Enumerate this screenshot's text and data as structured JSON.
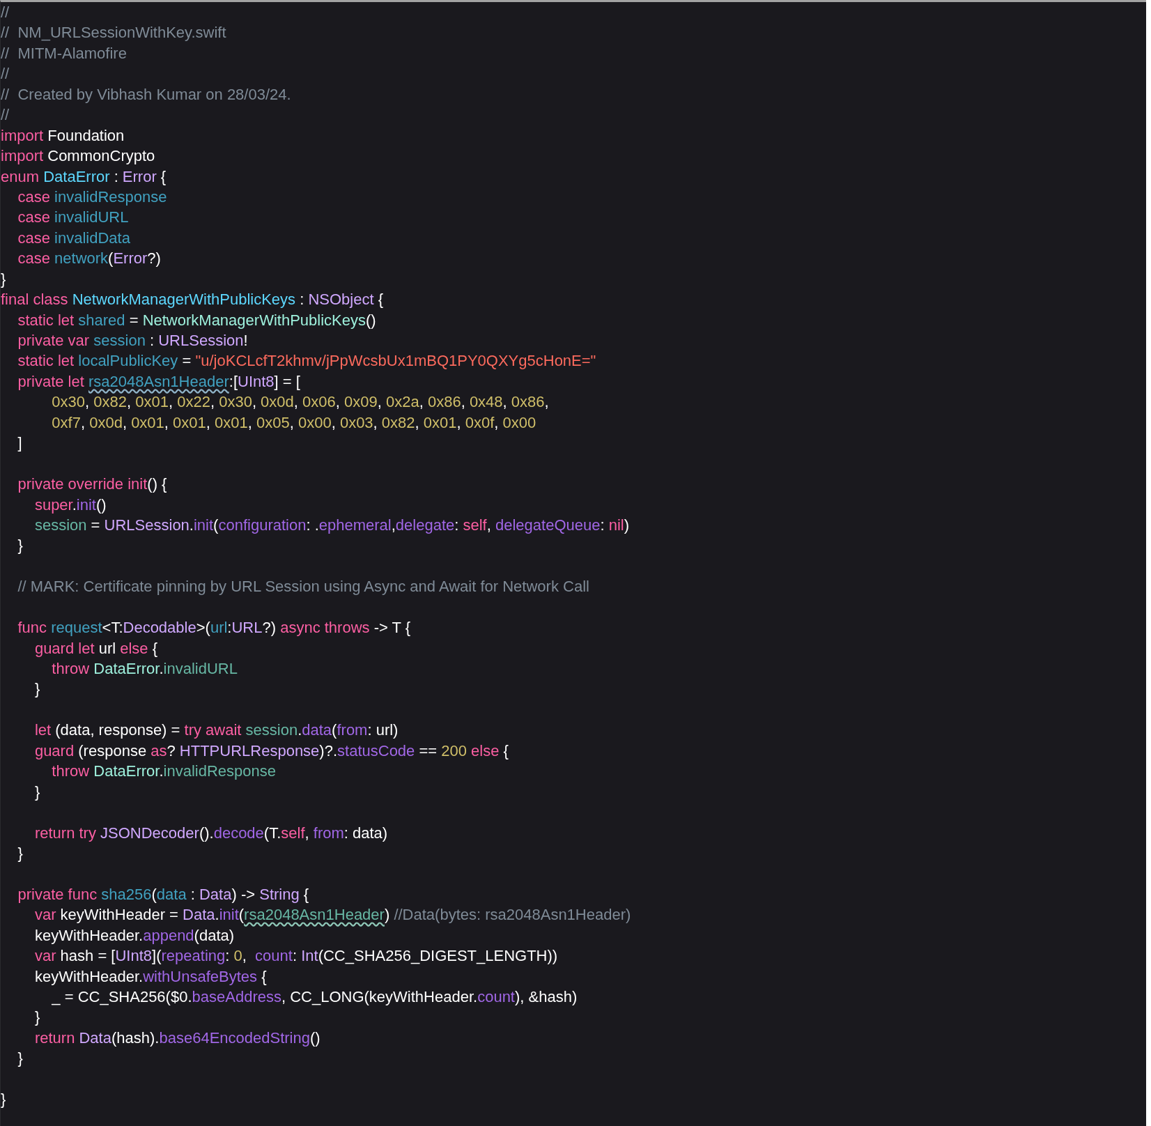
{
  "editor": {
    "lines": [
      {
        "kind": "code",
        "tokens": [
          {
            "text": "//",
            "kind": "comment"
          }
        ]
      },
      {
        "kind": "code",
        "tokens": [
          {
            "text": "//  NM_URLSessionWithKey.swift",
            "kind": "comment"
          }
        ]
      },
      {
        "kind": "code",
        "tokens": [
          {
            "text": "//  MITM-Alamofire",
            "kind": "comment"
          }
        ]
      },
      {
        "kind": "code",
        "tokens": [
          {
            "text": "//",
            "kind": "comment"
          }
        ]
      },
      {
        "kind": "code",
        "tokens": [
          {
            "text": "//  Created by Vibhash Kumar on 28/03/24.",
            "kind": "comment"
          }
        ]
      },
      {
        "kind": "code",
        "tokens": [
          {
            "text": "//",
            "kind": "comment"
          }
        ]
      },
      {
        "kind": "code",
        "tokens": [
          {
            "text": "import ",
            "kind": "keyword"
          },
          {
            "text": "Foundation",
            "kind": "plain"
          }
        ]
      },
      {
        "kind": "code",
        "tokens": [
          {
            "text": "import ",
            "kind": "keyword"
          },
          {
            "text": "CommonCrypto",
            "kind": "plain"
          }
        ]
      },
      {
        "kind": "code",
        "tokens": [
          {
            "text": "enum ",
            "kind": "keyword"
          },
          {
            "text": "DataError",
            "kind": "decl-type"
          },
          {
            "text": " : ",
            "kind": "plain"
          },
          {
            "text": "Error",
            "kind": "type"
          },
          {
            "text": " {",
            "kind": "plain"
          }
        ]
      },
      {
        "kind": "code",
        "tokens": [
          {
            "text": "    case ",
            "kind": "keyword"
          },
          {
            "text": "invalidResponse",
            "kind": "decl"
          }
        ]
      },
      {
        "kind": "code",
        "tokens": [
          {
            "text": "    case ",
            "kind": "keyword"
          },
          {
            "text": "invalidURL",
            "kind": "decl"
          }
        ]
      },
      {
        "kind": "code",
        "tokens": [
          {
            "text": "    case ",
            "kind": "keyword"
          },
          {
            "text": "invalidData",
            "kind": "decl"
          }
        ]
      },
      {
        "kind": "code",
        "tokens": [
          {
            "text": "    case ",
            "kind": "keyword"
          },
          {
            "text": "network",
            "kind": "decl"
          },
          {
            "text": "(",
            "kind": "plain"
          },
          {
            "text": "Error",
            "kind": "type"
          },
          {
            "text": "?)",
            "kind": "plain"
          }
        ]
      },
      {
        "kind": "code",
        "tokens": [
          {
            "text": "}",
            "kind": "plain"
          }
        ]
      },
      {
        "kind": "code",
        "tokens": [
          {
            "text": "final class ",
            "kind": "keyword"
          },
          {
            "text": "NetworkManagerWithPublicKeys",
            "kind": "decl-type"
          },
          {
            "text": " : ",
            "kind": "plain"
          },
          {
            "text": "NSObject",
            "kind": "type"
          },
          {
            "text": " {",
            "kind": "plain"
          }
        ]
      },
      {
        "kind": "code",
        "tokens": [
          {
            "text": "    static let ",
            "kind": "keyword"
          },
          {
            "text": "shared",
            "kind": "decl"
          },
          {
            "text": " = ",
            "kind": "plain"
          },
          {
            "text": "NetworkManagerWithPublicKeys",
            "kind": "proj-type"
          },
          {
            "text": "()",
            "kind": "plain"
          }
        ]
      },
      {
        "kind": "code",
        "tokens": [
          {
            "text": "    private var ",
            "kind": "keyword"
          },
          {
            "text": "session",
            "kind": "decl"
          },
          {
            "text": " : ",
            "kind": "plain"
          },
          {
            "text": "URLSession",
            "kind": "type"
          },
          {
            "text": "!",
            "kind": "plain"
          }
        ]
      },
      {
        "kind": "code",
        "tokens": [
          {
            "text": "    static let ",
            "kind": "keyword"
          },
          {
            "text": "localPublicKey",
            "kind": "decl"
          },
          {
            "text": " = ",
            "kind": "plain"
          },
          {
            "text": "\"u/joKCLcfT2khmv/jPpWcsbUx1mBQ1PY0QXYg5cHonE=\"",
            "kind": "string"
          }
        ]
      },
      {
        "kind": "code",
        "tokens": [
          {
            "text": "    private let ",
            "kind": "keyword"
          },
          {
            "text": "rsa2048Asn1Header",
            "kind": "decl-warn"
          },
          {
            "text": ":[",
            "kind": "plain"
          },
          {
            "text": "UInt8",
            "kind": "type"
          },
          {
            "text": "] = [",
            "kind": "plain"
          }
        ]
      },
      {
        "kind": "code",
        "tokens": [
          {
            "text": "            0x30",
            "kind": "number"
          },
          {
            "text": ", ",
            "kind": "plain"
          },
          {
            "text": "0x82",
            "kind": "number"
          },
          {
            "text": ", ",
            "kind": "plain"
          },
          {
            "text": "0x01",
            "kind": "number"
          },
          {
            "text": ", ",
            "kind": "plain"
          },
          {
            "text": "0x22",
            "kind": "number"
          },
          {
            "text": ", ",
            "kind": "plain"
          },
          {
            "text": "0x30",
            "kind": "number"
          },
          {
            "text": ", ",
            "kind": "plain"
          },
          {
            "text": "0x0d",
            "kind": "number"
          },
          {
            "text": ", ",
            "kind": "plain"
          },
          {
            "text": "0x06",
            "kind": "number"
          },
          {
            "text": ", ",
            "kind": "plain"
          },
          {
            "text": "0x09",
            "kind": "number"
          },
          {
            "text": ", ",
            "kind": "plain"
          },
          {
            "text": "0x2a",
            "kind": "number"
          },
          {
            "text": ", ",
            "kind": "plain"
          },
          {
            "text": "0x86",
            "kind": "number"
          },
          {
            "text": ", ",
            "kind": "plain"
          },
          {
            "text": "0x48",
            "kind": "number"
          },
          {
            "text": ", ",
            "kind": "plain"
          },
          {
            "text": "0x86",
            "kind": "number"
          },
          {
            "text": ",",
            "kind": "plain"
          }
        ]
      },
      {
        "kind": "code",
        "tokens": [
          {
            "text": "            0xf7",
            "kind": "number"
          },
          {
            "text": ", ",
            "kind": "plain"
          },
          {
            "text": "0x0d",
            "kind": "number"
          },
          {
            "text": ", ",
            "kind": "plain"
          },
          {
            "text": "0x01",
            "kind": "number"
          },
          {
            "text": ", ",
            "kind": "plain"
          },
          {
            "text": "0x01",
            "kind": "number"
          },
          {
            "text": ", ",
            "kind": "plain"
          },
          {
            "text": "0x01",
            "kind": "number"
          },
          {
            "text": ", ",
            "kind": "plain"
          },
          {
            "text": "0x05",
            "kind": "number"
          },
          {
            "text": ", ",
            "kind": "plain"
          },
          {
            "text": "0x00",
            "kind": "number"
          },
          {
            "text": ", ",
            "kind": "plain"
          },
          {
            "text": "0x03",
            "kind": "number"
          },
          {
            "text": ", ",
            "kind": "plain"
          },
          {
            "text": "0x82",
            "kind": "number"
          },
          {
            "text": ", ",
            "kind": "plain"
          },
          {
            "text": "0x01",
            "kind": "number"
          },
          {
            "text": ", ",
            "kind": "plain"
          },
          {
            "text": "0x0f",
            "kind": "number"
          },
          {
            "text": ", ",
            "kind": "plain"
          },
          {
            "text": "0x00",
            "kind": "number"
          }
        ]
      },
      {
        "kind": "code",
        "tokens": [
          {
            "text": "    ]",
            "kind": "plain"
          }
        ]
      },
      {
        "kind": "blank"
      },
      {
        "kind": "code",
        "tokens": [
          {
            "text": "    private override init",
            "kind": "keyword"
          },
          {
            "text": "() {",
            "kind": "plain"
          }
        ]
      },
      {
        "kind": "code",
        "tokens": [
          {
            "text": "        super",
            "kind": "keyword"
          },
          {
            "text": ".",
            "kind": "plain"
          },
          {
            "text": "init",
            "kind": "member"
          },
          {
            "text": "()",
            "kind": "plain"
          }
        ]
      },
      {
        "kind": "code",
        "tokens": [
          {
            "text": "        session",
            "kind": "proj-member"
          },
          {
            "text": " = ",
            "kind": "plain"
          },
          {
            "text": "URLSession",
            "kind": "type"
          },
          {
            "text": ".",
            "kind": "plain"
          },
          {
            "text": "init",
            "kind": "member"
          },
          {
            "text": "(",
            "kind": "plain"
          },
          {
            "text": "configuration",
            "kind": "member"
          },
          {
            "text": ": .",
            "kind": "plain"
          },
          {
            "text": "ephemeral",
            "kind": "member"
          },
          {
            "text": ",",
            "kind": "plain"
          },
          {
            "text": "delegate",
            "kind": "member"
          },
          {
            "text": ": ",
            "kind": "plain"
          },
          {
            "text": "self",
            "kind": "keyword"
          },
          {
            "text": ", ",
            "kind": "plain"
          },
          {
            "text": "delegateQueue",
            "kind": "member"
          },
          {
            "text": ": ",
            "kind": "plain"
          },
          {
            "text": "nil",
            "kind": "keyword"
          },
          {
            "text": ")",
            "kind": "plain"
          }
        ]
      },
      {
        "kind": "code",
        "tokens": [
          {
            "text": "    }",
            "kind": "plain"
          }
        ]
      },
      {
        "kind": "blank"
      },
      {
        "kind": "code",
        "tokens": [
          {
            "text": "    // MARK: Certificate pinning by URL Session using Async and Await for Network Call",
            "kind": "comment"
          }
        ]
      },
      {
        "kind": "blank"
      },
      {
        "kind": "code",
        "tokens": [
          {
            "text": "    func ",
            "kind": "keyword"
          },
          {
            "text": "request",
            "kind": "decl"
          },
          {
            "text": "<T:",
            "kind": "plain"
          },
          {
            "text": "Decodable",
            "kind": "type"
          },
          {
            "text": ">(",
            "kind": "plain"
          },
          {
            "text": "url",
            "kind": "decl"
          },
          {
            "text": ":",
            "kind": "plain"
          },
          {
            "text": "URL",
            "kind": "type"
          },
          {
            "text": "?) ",
            "kind": "plain"
          },
          {
            "text": "async throws ",
            "kind": "keyword"
          },
          {
            "text": "-> T {",
            "kind": "plain"
          }
        ]
      },
      {
        "kind": "code",
        "tokens": [
          {
            "text": "        guard let ",
            "kind": "keyword"
          },
          {
            "text": "url ",
            "kind": "plain"
          },
          {
            "text": "else ",
            "kind": "keyword"
          },
          {
            "text": "{",
            "kind": "plain"
          }
        ]
      },
      {
        "kind": "code",
        "tokens": [
          {
            "text": "            throw ",
            "kind": "keyword"
          },
          {
            "text": "DataError",
            "kind": "proj-type"
          },
          {
            "text": ".",
            "kind": "plain"
          },
          {
            "text": "invalidURL",
            "kind": "proj-member"
          }
        ]
      },
      {
        "kind": "code",
        "tokens": [
          {
            "text": "        }",
            "kind": "plain"
          }
        ]
      },
      {
        "kind": "blank"
      },
      {
        "kind": "code",
        "tokens": [
          {
            "text": "        let ",
            "kind": "keyword"
          },
          {
            "text": "(data, response) = ",
            "kind": "plain"
          },
          {
            "text": "try await ",
            "kind": "keyword"
          },
          {
            "text": "session",
            "kind": "proj-member"
          },
          {
            "text": ".",
            "kind": "plain"
          },
          {
            "text": "data",
            "kind": "member"
          },
          {
            "text": "(",
            "kind": "plain"
          },
          {
            "text": "from",
            "kind": "member"
          },
          {
            "text": ": url)",
            "kind": "plain"
          }
        ]
      },
      {
        "kind": "code",
        "tokens": [
          {
            "text": "        guard ",
            "kind": "keyword"
          },
          {
            "text": "(response ",
            "kind": "plain"
          },
          {
            "text": "as",
            "kind": "keyword"
          },
          {
            "text": "? ",
            "kind": "plain"
          },
          {
            "text": "HTTPURLResponse",
            "kind": "type"
          },
          {
            "text": ")?.",
            "kind": "plain"
          },
          {
            "text": "statusCode",
            "kind": "member"
          },
          {
            "text": " == ",
            "kind": "plain"
          },
          {
            "text": "200",
            "kind": "number"
          },
          {
            "text": " else ",
            "kind": "keyword"
          },
          {
            "text": "{",
            "kind": "plain"
          }
        ]
      },
      {
        "kind": "code",
        "tokens": [
          {
            "text": "            throw ",
            "kind": "keyword"
          },
          {
            "text": "DataError",
            "kind": "proj-type"
          },
          {
            "text": ".",
            "kind": "plain"
          },
          {
            "text": "invalidResponse",
            "kind": "proj-member"
          }
        ]
      },
      {
        "kind": "code",
        "tokens": [
          {
            "text": "        }",
            "kind": "plain"
          }
        ]
      },
      {
        "kind": "blank"
      },
      {
        "kind": "code",
        "tokens": [
          {
            "text": "        return try ",
            "kind": "keyword"
          },
          {
            "text": "JSONDecoder",
            "kind": "type"
          },
          {
            "text": "().",
            "kind": "plain"
          },
          {
            "text": "decode",
            "kind": "member"
          },
          {
            "text": "(T.",
            "kind": "plain"
          },
          {
            "text": "self",
            "kind": "keyword"
          },
          {
            "text": ", ",
            "kind": "plain"
          },
          {
            "text": "from",
            "kind": "member"
          },
          {
            "text": ": data)",
            "kind": "plain"
          }
        ]
      },
      {
        "kind": "code",
        "tokens": [
          {
            "text": "    }",
            "kind": "plain"
          }
        ]
      },
      {
        "kind": "blank"
      },
      {
        "kind": "code",
        "tokens": [
          {
            "text": "    private func ",
            "kind": "keyword"
          },
          {
            "text": "sha256",
            "kind": "decl"
          },
          {
            "text": "(",
            "kind": "plain"
          },
          {
            "text": "data",
            "kind": "decl"
          },
          {
            "text": " : ",
            "kind": "plain"
          },
          {
            "text": "Data",
            "kind": "type"
          },
          {
            "text": ") -> ",
            "kind": "plain"
          },
          {
            "text": "String",
            "kind": "type"
          },
          {
            "text": " {",
            "kind": "plain"
          }
        ]
      },
      {
        "kind": "code",
        "tokens": [
          {
            "text": "        var ",
            "kind": "keyword"
          },
          {
            "text": "keyWithHeader = ",
            "kind": "plain"
          },
          {
            "text": "Data",
            "kind": "type"
          },
          {
            "text": ".",
            "kind": "plain"
          },
          {
            "text": "init",
            "kind": "member"
          },
          {
            "text": "(",
            "kind": "plain"
          },
          {
            "text": "rsa2048Asn1Header",
            "kind": "proj-warn"
          },
          {
            "text": ") ",
            "kind": "plain"
          },
          {
            "text": "//Data(bytes: rsa2048Asn1Header)",
            "kind": "comment"
          }
        ]
      },
      {
        "kind": "code",
        "tokens": [
          {
            "text": "        keyWithHeader.",
            "kind": "plain"
          },
          {
            "text": "append",
            "kind": "member"
          },
          {
            "text": "(data)",
            "kind": "plain"
          }
        ]
      },
      {
        "kind": "code",
        "tokens": [
          {
            "text": "        var ",
            "kind": "keyword"
          },
          {
            "text": "hash = [",
            "kind": "plain"
          },
          {
            "text": "UInt8",
            "kind": "type"
          },
          {
            "text": "](",
            "kind": "plain"
          },
          {
            "text": "repeating",
            "kind": "member"
          },
          {
            "text": ": ",
            "kind": "plain"
          },
          {
            "text": "0",
            "kind": "number"
          },
          {
            "text": ",  ",
            "kind": "plain"
          },
          {
            "text": "count",
            "kind": "member"
          },
          {
            "text": ": ",
            "kind": "plain"
          },
          {
            "text": "Int",
            "kind": "type"
          },
          {
            "text": "(CC_SHA256_DIGEST_LENGTH))",
            "kind": "plain"
          }
        ]
      },
      {
        "kind": "code",
        "tokens": [
          {
            "text": "        keyWithHeader.",
            "kind": "plain"
          },
          {
            "text": "withUnsafeBytes",
            "kind": "member"
          },
          {
            "text": " {",
            "kind": "plain"
          }
        ]
      },
      {
        "kind": "code",
        "tokens": [
          {
            "text": "            _ = CC_SHA256($0.",
            "kind": "plain"
          },
          {
            "text": "baseAddress",
            "kind": "member"
          },
          {
            "text": ", CC_LONG(keyWithHeader.",
            "kind": "plain"
          },
          {
            "text": "count",
            "kind": "member"
          },
          {
            "text": "), &hash)",
            "kind": "plain"
          }
        ]
      },
      {
        "kind": "code",
        "tokens": [
          {
            "text": "        }",
            "kind": "plain"
          }
        ]
      },
      {
        "kind": "code",
        "tokens": [
          {
            "text": "        return ",
            "kind": "keyword"
          },
          {
            "text": "Data",
            "kind": "type"
          },
          {
            "text": "(hash).",
            "kind": "plain"
          },
          {
            "text": "base64EncodedString",
            "kind": "member"
          },
          {
            "text": "()",
            "kind": "plain"
          }
        ]
      },
      {
        "kind": "code",
        "tokens": [
          {
            "text": "    }",
            "kind": "plain"
          }
        ]
      },
      {
        "kind": "blank"
      },
      {
        "kind": "code",
        "tokens": [
          {
            "text": "}",
            "kind": "plain"
          }
        ]
      }
    ]
  }
}
